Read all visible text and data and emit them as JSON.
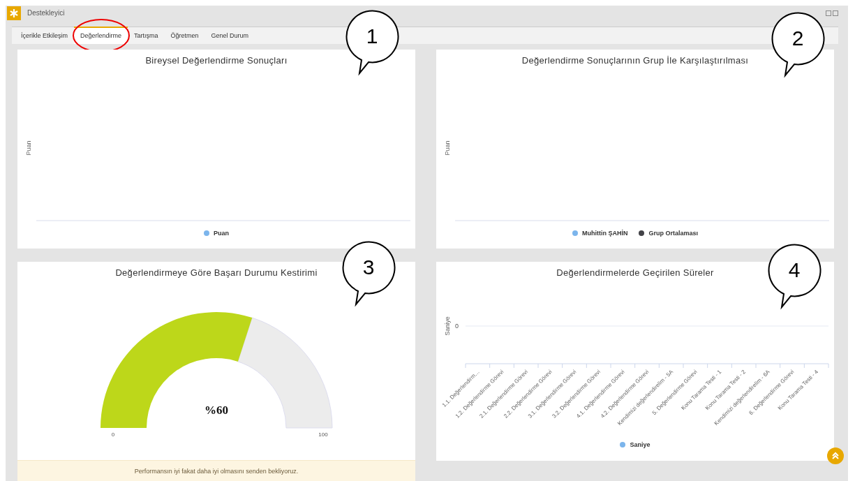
{
  "window": {
    "title": "Destekleyici"
  },
  "tabs": [
    {
      "label": "İçerikle Etkileşim",
      "selected": false,
      "circled": false
    },
    {
      "label": "Değerlendirme",
      "selected": true,
      "circled": true
    },
    {
      "label": "Tartışma",
      "selected": false,
      "circled": false
    },
    {
      "label": "Öğretmen",
      "selected": false,
      "circled": false
    },
    {
      "label": "Genel Durum",
      "selected": false,
      "circled": false
    }
  ],
  "cards": [
    {
      "kind": "chart",
      "title": "Bireysel Değerlendirme Sonuçları",
      "ylabel": "Puan",
      "legend": [
        {
          "name": "Puan",
          "color": "#7cb5ec"
        }
      ]
    },
    {
      "kind": "chart",
      "title": "Değerlendirme Sonuçlarının Grup İle Karşılaştırılması",
      "ylabel": "Puan",
      "legend": [
        {
          "name": "Muhittin ŞAHİN",
          "color": "#7cb5ec"
        },
        {
          "name": "Grup Ortalaması",
          "color": "#434348"
        }
      ]
    },
    {
      "kind": "gauge",
      "title": "Değerlendirmeye Göre Başarı Durumu Kestirimi",
      "reading": "%60",
      "min_label": "0",
      "max_label": "100",
      "message": "Performansın iyi fakat daha iyi olmasını senden bekliyoruz."
    },
    {
      "kind": "category_chart",
      "title": "Değerlendirmelerde Geçirilen Süreler",
      "ylabel": "Saniye",
      "y_tick": "0",
      "categories": [
        "1.1. Değerlendirm…",
        "1.2. Değerlendirme Görevi",
        "2.1. Değerlendirme Görevi",
        "2.2. Değerlendirme Görevi",
        "3.1. Değerlendirme Görevi",
        "3.2. Değerlendirme Görevi",
        "4.1. Değerlendirme Görevi",
        "4.2. Değerlendirme Görevi",
        "Kendimizi değerlendirelim - 5A",
        "5. Değerlendirme Görevi",
        "Konu Tarama Testi - 1",
        "Konu Tarama Testi - 2",
        "Kendimizi değerlendirelim - 6A",
        "6. Değerlendirme Görevi",
        "Konu Tarama Testi - 4"
      ],
      "legend": [
        {
          "name": "Saniye",
          "color": "#7cb5ec"
        }
      ]
    }
  ],
  "callouts": [
    {
      "number": "1"
    },
    {
      "number": "2"
    },
    {
      "number": "3"
    },
    {
      "number": "4"
    }
  ]
}
